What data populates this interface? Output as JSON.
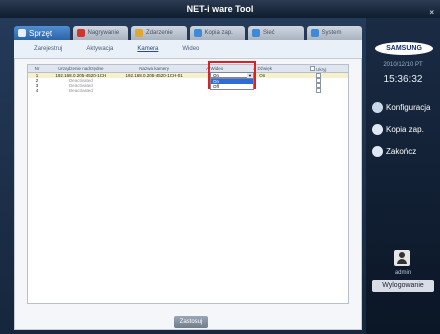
{
  "window": {
    "title": "NET-i ware Tool",
    "close_glyph": "×"
  },
  "tabs": [
    {
      "label": "Sprzęt",
      "icon": "hardware-icon",
      "color": "#ffffff"
    },
    {
      "label": "Nagrywanie",
      "icon": "record-icon",
      "color": "#d0342c"
    },
    {
      "label": "Zdarzenie",
      "icon": "event-icon",
      "color": "#e0a82e"
    },
    {
      "label": "Kopia zap.",
      "icon": "backup-icon",
      "color": "#3d8ad8"
    },
    {
      "label": "Sieć",
      "icon": "network-icon",
      "color": "#3d8ad8"
    },
    {
      "label": "System",
      "icon": "system-icon",
      "color": "#3d8ad8"
    }
  ],
  "subtabs": [
    "Zarejestruj",
    "Aktywacja",
    "Kamera",
    "Wideo"
  ],
  "table": {
    "headers": [
      "Nr",
      "Urządzenie nadrzędne",
      "Nazwa kamery",
      "✓   Wideo",
      "✓   Dźwięk",
      "Ukryj"
    ],
    "rows": [
      {
        "nr": "1",
        "device": "192.168.0.205-4520-1CH",
        "camera": "192.168.0.205-4520-1CH-01",
        "video": "On",
        "audio": "On",
        "hide": ""
      },
      {
        "nr": "2",
        "device": "Deactivated",
        "camera": "",
        "video": "",
        "audio": "",
        "hide": ""
      },
      {
        "nr": "3",
        "device": "Deactivated",
        "camera": "",
        "video": "",
        "audio": "",
        "hide": ""
      },
      {
        "nr": "4",
        "device": "Deactivated",
        "camera": "",
        "video": "",
        "audio": "",
        "hide": ""
      }
    ]
  },
  "video_dropdown": {
    "value": "On",
    "options": [
      "On",
      "Off"
    ],
    "arrow": "▼"
  },
  "apply_label": "Zastosuj",
  "sidebar": {
    "logo": "SAMSUNG",
    "date": "2010/12/10 PT",
    "time": "15:36:32",
    "menu": [
      {
        "label": "Konfiguracja",
        "icon": "gear-icon"
      },
      {
        "label": "Kopia zap.",
        "icon": "backup-icon"
      },
      {
        "label": "Zakończ",
        "icon": "power-icon"
      }
    ],
    "user": "admin",
    "logout_label": "Wylogowanie"
  }
}
